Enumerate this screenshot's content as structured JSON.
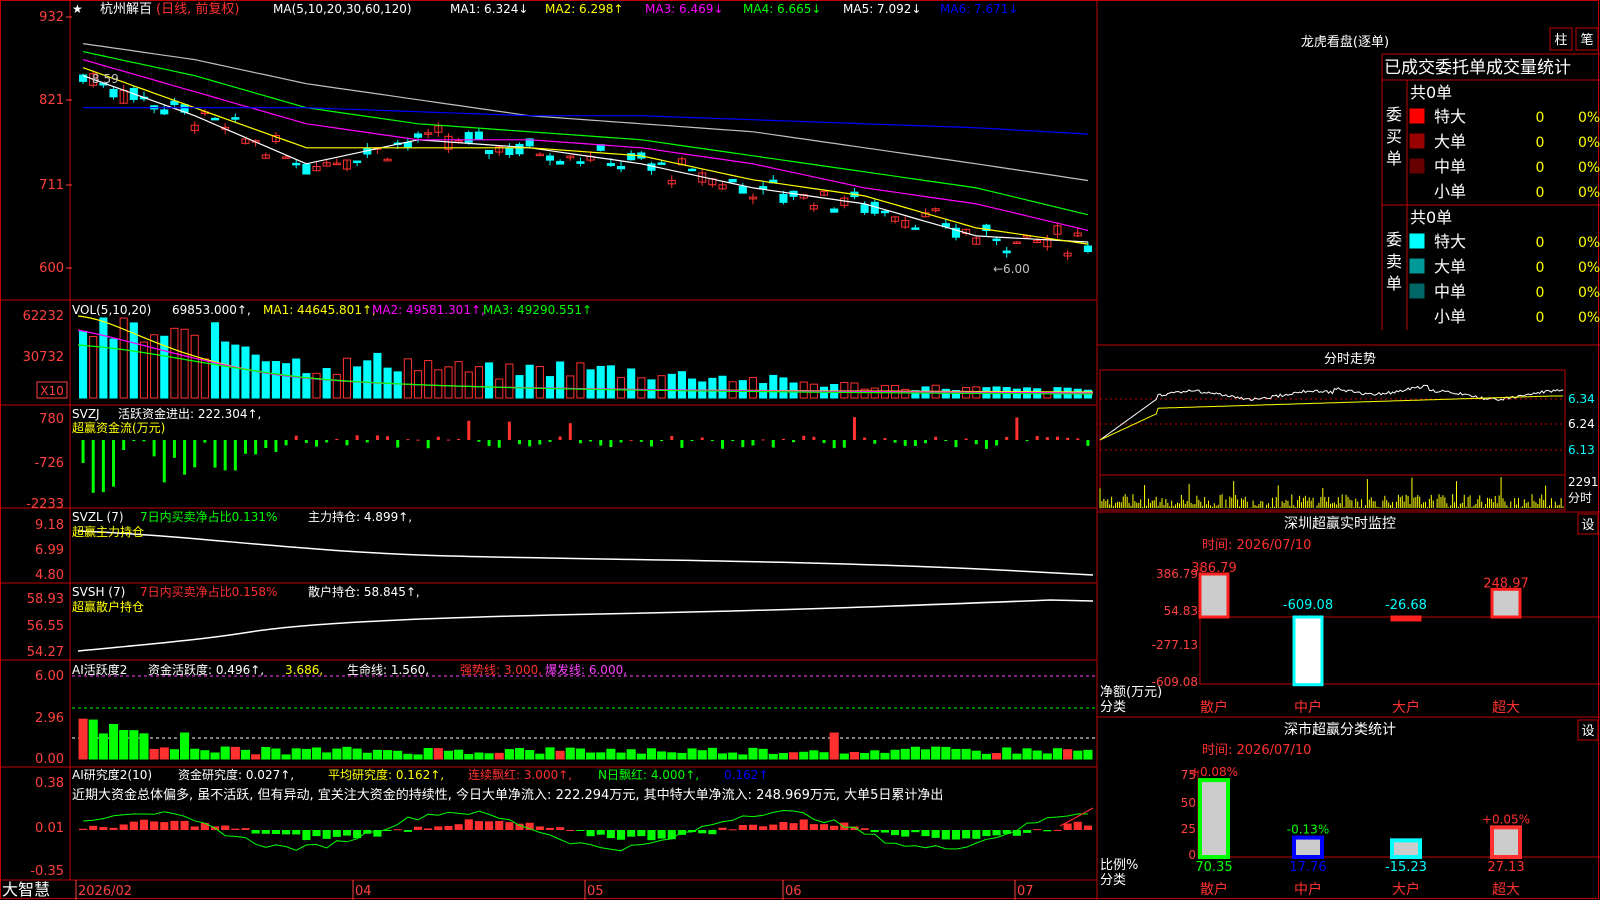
{
  "colors": {
    "up": "#ff3030",
    "down": "#00ffff",
    "white": "#ffffff",
    "yellow": "#ffff00",
    "magenta": "#ff00ff",
    "green": "#00ff00",
    "blue": "#0000ff",
    "gray": "#c0c0c0",
    "red_grid": "#c00000",
    "axis_red": "#ff4040",
    "green_bar": "#00ff00",
    "purple": "#ff40ff"
  },
  "header": {
    "star": "★",
    "name": "杭州解百",
    "mode": "(日线, 前复权)",
    "ma_label": "MA(5,10,20,30,60,120)",
    "ma1": "MA1: 6.324↓",
    "ma2": "MA2: 6.298↑",
    "ma3": "MA3: 6.469↓",
    "ma4": "MA4: 6.665↓",
    "ma5": "MA5: 7.092↓",
    "ma6": "MA6: 7.671↓"
  },
  "price_panel": {
    "y_ticks": [
      "932",
      "821",
      "711",
      "600"
    ],
    "high_mark": "8.59",
    "low_mark": "←6.00"
  },
  "vol_panel": {
    "title": "VOL(5,10,20)",
    "value": "69853.000↑,",
    "ma1": "MA1: 44645.801↑,",
    "ma2": "MA2: 49581.301↑,",
    "ma3": "MA3: 49290.551↑",
    "y_ticks": [
      "62232",
      "30732"
    ],
    "unit": "X10"
  },
  "svzj_panel": {
    "title": "SVZJ",
    "text": "活跃资金进出: 222.304↑,",
    "subtitle": "超赢资金流(万元)",
    "y_ticks": [
      "780",
      "-726",
      "-2233"
    ]
  },
  "svzl_panel": {
    "title": "SVZL (7)",
    "text1": "7日内买卖净占比0.131%",
    "text2": "主力持仓: 4.899↑,",
    "subtitle": "超赢主力持仓",
    "y_ticks": [
      "9.18",
      "6.99",
      "4.80"
    ]
  },
  "svsh_panel": {
    "title": "SVSH (7)",
    "text1": "7日内买卖净占比0.158%",
    "text2": "散户持仓: 58.845↑,",
    "subtitle": "超赢散户持仓",
    "y_ticks": [
      "58.93",
      "56.55",
      "54.27"
    ]
  },
  "ai_active_panel": {
    "title": "AI活跃度2",
    "t1": "资金活跃度: 0.496↑,",
    "t2": "3.686,",
    "t3": "生命线: 1.560,",
    "t4": "强势线: 3.000,",
    "t5": "爆发线: 6.000,",
    "y_ticks": [
      "6.00",
      "2.96",
      "0.00"
    ]
  },
  "ai_research_panel": {
    "title": "AI研究度2(10)",
    "t1": "资金研究度: 0.027↑,",
    "t2": "平均研究度: 0.162↑,",
    "t3": "连续飘红: 3.000↑,",
    "t4": "N日飘红: 4.000↑,",
    "t5": "0.162↑",
    "comment": "近期大资金总体偏多, 虽不活跃, 但有异动, 宜关注大资金的持续性, 今日大单净流入: 222.294万元, 其中特大单净流入: 248.969万元, 大单5日累计净出",
    "y_ticks": [
      "0.38",
      "0.01",
      "-0.35"
    ]
  },
  "x_axis": {
    "labels": [
      "2026/02",
      "04",
      "05",
      "06",
      "07"
    ],
    "logo": "大智慧"
  },
  "right": {
    "dragon_title": "龙虎看盘(逐单)",
    "btn_bar": "柱",
    "btn_pen": "笔",
    "tab_title": "已成交委托单成交量统计",
    "buy_side": {
      "label": "委买单",
      "total": "共0单",
      "rows": [
        {
          "name": "特大",
          "val": "0",
          "pct": "0%",
          "color": "#ff0000"
        },
        {
          "name": "大单",
          "val": "0",
          "pct": "0%",
          "color": "#990000"
        },
        {
          "name": "中单",
          "val": "0",
          "pct": "0%",
          "color": "#660000"
        },
        {
          "name": "小单",
          "val": "0",
          "pct": "0%",
          "color": "#000000"
        }
      ]
    },
    "sell_side": {
      "label": "委卖单",
      "total": "共0单",
      "rows": [
        {
          "name": "特大",
          "val": "0",
          "pct": "0%",
          "color": "#00ffff"
        },
        {
          "name": "大单",
          "val": "0",
          "pct": "0%",
          "color": "#009999"
        },
        {
          "name": "中单",
          "val": "0",
          "pct": "0%",
          "color": "#006666"
        },
        {
          "name": "小单",
          "val": "0",
          "pct": "0%",
          "color": "#000000"
        }
      ]
    },
    "intraday": {
      "title": "分时走势",
      "y_ticks": [
        "6.34",
        "6.24",
        "6.13"
      ],
      "vol_tick": "2291",
      "vol_unit": "分时"
    },
    "monitor": {
      "title": "深圳超赢实时监控",
      "set": "设",
      "time": "时间: 2026/07/10",
      "y_ticks": [
        "386.79",
        "54.83",
        "-277.13",
        "-609.08"
      ],
      "ylabel1": "净额(万元)",
      "ylabel2": "分类",
      "categories": [
        "散户",
        "中户",
        "大户",
        "超大"
      ],
      "values": [
        "386.79",
        "-609.08",
        "-26.68",
        "248.97"
      ]
    },
    "classify": {
      "title": "深市超赢分类统计",
      "set": "设",
      "time": "时间: 2026/07/10",
      "y_ticks": [
        "75",
        "50",
        "25",
        "0"
      ],
      "ylabel1": "比例%",
      "ylabel2": "分类",
      "categories": [
        "散户",
        "中户",
        "大户",
        "超大"
      ],
      "bar_labels": [
        "+0.08%",
        "-0.13%",
        "",
        "+0.05%"
      ],
      "values": [
        "70.35",
        "17.76",
        "-15.23",
        "27.13"
      ]
    }
  },
  "chart_data": [
    {
      "type": "line",
      "title": "杭州解百 (日线, 前复权)",
      "x": [
        "2026/02",
        "04",
        "05",
        "06",
        "07"
      ],
      "series": [
        {
          "name": "MA1",
          "values": [
            8.4,
            7.9,
            7.3,
            7.6,
            7.5,
            7.3,
            7.0,
            6.8,
            6.4,
            6.324
          ]
        },
        {
          "name": "MA2",
          "values": [
            8.5,
            8.0,
            7.5,
            7.5,
            7.5,
            7.4,
            7.1,
            6.9,
            6.5,
            6.298
          ]
        },
        {
          "name": "MA3",
          "values": [
            8.6,
            8.2,
            7.8,
            7.6,
            7.6,
            7.5,
            7.3,
            7.0,
            6.8,
            6.469
          ]
        },
        {
          "name": "MA4",
          "values": [
            8.7,
            8.4,
            8.0,
            7.8,
            7.7,
            7.6,
            7.4,
            7.2,
            7.0,
            6.665
          ]
        },
        {
          "name": "MA5",
          "values": [
            8.8,
            8.6,
            8.3,
            8.1,
            7.9,
            7.8,
            7.7,
            7.5,
            7.3,
            7.092
          ]
        },
        {
          "name": "MA6",
          "values": [
            8.0,
            8.0,
            8.0,
            7.95,
            7.9,
            7.9,
            7.85,
            7.8,
            7.75,
            7.671
          ]
        }
      ],
      "ylim": [
        6.0,
        9.32
      ]
    },
    {
      "type": "bar",
      "title": "VOL(5,10,20)",
      "values": [
        62232,
        55000,
        48000,
        50000,
        30000,
        28000,
        32000,
        25000,
        22000,
        26000,
        24000,
        20000,
        18000,
        15000,
        12000,
        10000,
        9000,
        8000,
        7000,
        6985
      ]
    },
    {
      "type": "bar",
      "title": "超赢资金流(万元)",
      "values": [
        -726,
        -2000,
        -300,
        -2233,
        -1500,
        -900,
        -200,
        300,
        -400,
        -600,
        780,
        -350,
        -200,
        -100,
        222
      ]
    },
    {
      "type": "bar",
      "title": "深圳超赢实时监控",
      "categories": [
        "散户",
        "中户",
        "大户",
        "超大"
      ],
      "values": [
        386.79,
        -609.08,
        -26.68,
        248.97
      ]
    },
    {
      "type": "bar",
      "title": "深市超赢分类统计",
      "categories": [
        "散户",
        "中户",
        "大户",
        "超大"
      ],
      "values": [
        70.35,
        17.76,
        -15.23,
        27.13
      ]
    }
  ]
}
